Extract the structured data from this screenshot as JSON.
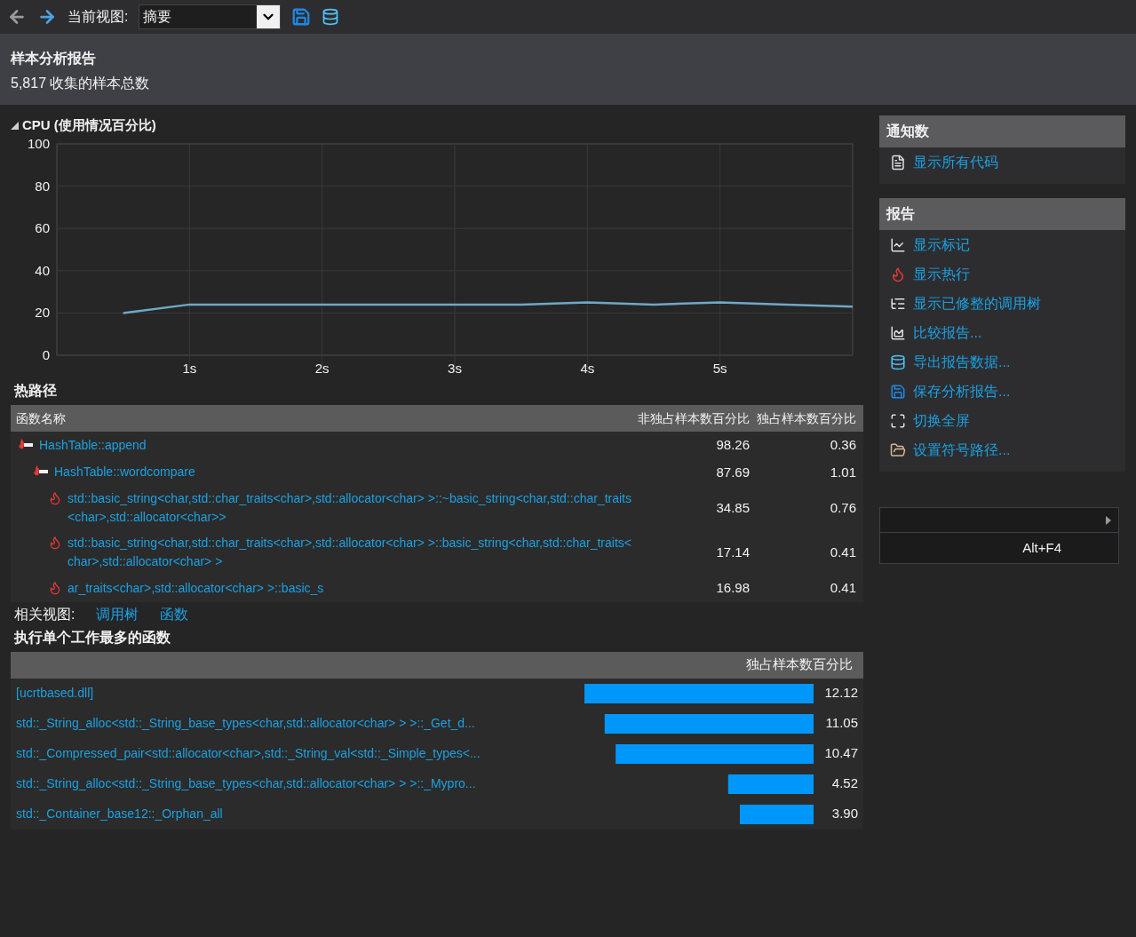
{
  "toolbar": {
    "back": {
      "disabled": true
    },
    "forward": {
      "disabled": false
    },
    "view_label": "当前视图:",
    "view_select": {
      "value": "摘要"
    }
  },
  "report": {
    "title": "样本分析报告",
    "summary": "5,817 收集的样本总数"
  },
  "cpu": {
    "chart_data": {
      "type": "line",
      "title": "CPU (使用情况百分比)",
      "x": [
        0.5,
        1,
        1.5,
        2,
        2.5,
        3,
        3.5,
        4,
        4.5,
        5,
        5.5,
        6
      ],
      "series": [
        {
          "color": "#6fa8c8",
          "values": [
            20,
            24,
            24,
            24,
            24,
            24,
            24,
            25,
            24,
            25,
            24,
            23
          ]
        }
      ],
      "grid": true,
      "xlim": [
        0,
        6
      ],
      "ylim": [
        0,
        100
      ],
      "xticks": [
        {
          "value": 1,
          "label": "1s"
        },
        {
          "value": 2,
          "label": "2s"
        },
        {
          "value": 3,
          "label": "3s"
        },
        {
          "value": 4,
          "label": "4s"
        },
        {
          "value": 5,
          "label": "5s"
        }
      ],
      "yticks": [
        0,
        20,
        40,
        60,
        80,
        100
      ]
    }
  },
  "hot_path": {
    "title": "热路径",
    "columns": [
      "函数名称",
      "非独占样本数百分比",
      "独占样本数百分比"
    ],
    "rows": [
      {
        "kind": "hot_path",
        "name": "HashTable::append",
        "inclusive": "98.26",
        "exclusive": "0.36",
        "children": [
          {
            "kind": "hot_path",
            "name": "HashTable::wordcompare",
            "inclusive": "87.69",
            "exclusive": "1.01",
            "children": [
              {
                "kind": "hot_spot",
                "name": "std::basic_string<char,std::char_traits<char>,std::allocator<char> >::~basic_string<char,std::char_traits<char>,std::allocator<char>>",
                "inclusive": "34.85",
                "exclusive": "0.76"
              },
              {
                "kind": "hot_spot",
                "name": "std::basic_string<char,std::char_traits<char>,std::allocator<char> >::basic_string<char,std::char_traits<char>,std::allocator<char> >",
                "inclusive": "17.14",
                "exclusive": "0.41"
              },
              {
                "kind": "hot_spot",
                "name": "ar_traits<char>,std::allocator<char> >::basic_s",
                "inclusive": "16.98",
                "exclusive": "0.41"
              }
            ]
          }
        ]
      }
    ]
  },
  "related_views": {
    "label": "相关视图:",
    "links": [
      "调用树",
      "函数"
    ]
  },
  "top_functions": {
    "title": "执行单个工作最多的函数",
    "chart_data": {
      "type": "bar",
      "orientation": "horizontal",
      "title": "独占样本数百分比",
      "categories": [
        "[ucrtbased.dll]",
        "std::_String_alloc<std::_String_base_types<char,std::allocator<char> > >::_Get_d...",
        "std::_Compressed_pair<std::allocator<char>,std::_String_val<std::_Simple_types<...",
        "std::_String_alloc<std::_String_base_types<char,std::allocator<char> > >::_Mypro...",
        "std::_Container_base12::_Orphan_all"
      ],
      "values": [
        12.12,
        11.05,
        10.47,
        4.52,
        3.9
      ],
      "value_labels": [
        "12.12",
        "11.05",
        "10.47",
        "4.52",
        "3.90"
      ]
    }
  },
  "side_panel": {
    "sections": [
      {
        "title": "通知数",
        "items": [
          "显示所有代码"
        ]
      },
      {
        "title": "报告",
        "items": [
          "显示标记",
          "显示热行",
          "显示已修整的调用树",
          "比较报告...",
          "导出报告数据...",
          "保存分析报告...",
          "切换全屏",
          "设置符号路径..."
        ]
      }
    ]
  },
  "context_menu": {
    "items": [
      {
        "kind": "submenu"
      },
      {
        "kind": "shortcut",
        "shortcut": "Alt+F4"
      }
    ]
  }
}
